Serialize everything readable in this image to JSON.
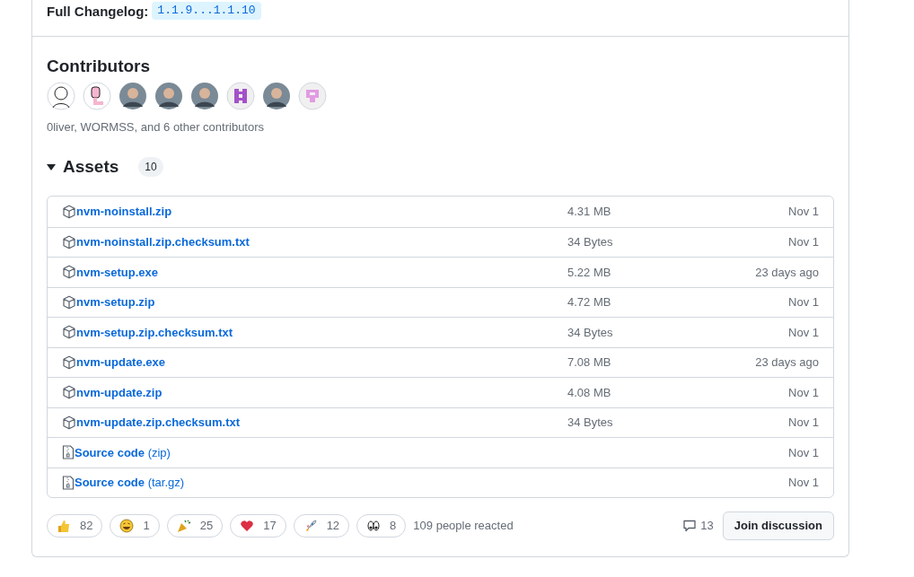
{
  "changelog": {
    "label": "Full Changelog:",
    "link": "1.1.9...1.1.10"
  },
  "contributors": {
    "title": "Contributors",
    "avatars": [
      {
        "kind": "sketch"
      },
      {
        "kind": "worm"
      },
      {
        "kind": "photo"
      },
      {
        "kind": "photo"
      },
      {
        "kind": "photo"
      },
      {
        "kind": "identicon"
      },
      {
        "kind": "photo"
      },
      {
        "kind": "identicon-light"
      }
    ],
    "summary": "0liver, WORMSS, and 6 other contributors"
  },
  "assets": {
    "title": "Assets",
    "expanded": true,
    "count": "10",
    "rows": [
      {
        "kind": "package",
        "name": "nvm-noinstall.zip",
        "size": "4.31 MB",
        "date": "Nov 1"
      },
      {
        "kind": "package",
        "name": "nvm-noinstall.zip.checksum.txt",
        "size": "34 Bytes",
        "date": "Nov 1"
      },
      {
        "kind": "package",
        "name": "nvm-setup.exe",
        "size": "5.22 MB",
        "date": "23 days ago"
      },
      {
        "kind": "package",
        "name": "nvm-setup.zip",
        "size": "4.72 MB",
        "date": "Nov 1"
      },
      {
        "kind": "package",
        "name": "nvm-setup.zip.checksum.txt",
        "size": "34 Bytes",
        "date": "Nov 1"
      },
      {
        "kind": "package",
        "name": "nvm-update.exe",
        "size": "7.08 MB",
        "date": "23 days ago"
      },
      {
        "kind": "package",
        "name": "nvm-update.zip",
        "size": "4.08 MB",
        "date": "Nov 1"
      },
      {
        "kind": "package",
        "name": "nvm-update.zip.checksum.txt",
        "size": "34 Bytes",
        "date": "Nov 1"
      },
      {
        "kind": "source",
        "name": "Source code",
        "format": "(zip)",
        "date": "Nov 1"
      },
      {
        "kind": "source",
        "name": "Source code",
        "format": "(tar.gz)",
        "date": "Nov 1"
      }
    ]
  },
  "reactions": [
    {
      "kind": "thumbs-up",
      "count": "82"
    },
    {
      "kind": "laugh",
      "count": "1"
    },
    {
      "kind": "hooray",
      "count": "25"
    },
    {
      "kind": "heart",
      "count": "17"
    },
    {
      "kind": "rocket",
      "count": "12"
    },
    {
      "kind": "eyes",
      "count": "8"
    }
  ],
  "reacted": "109 people reacted",
  "comments": "13",
  "join_button": "Join discussion"
}
